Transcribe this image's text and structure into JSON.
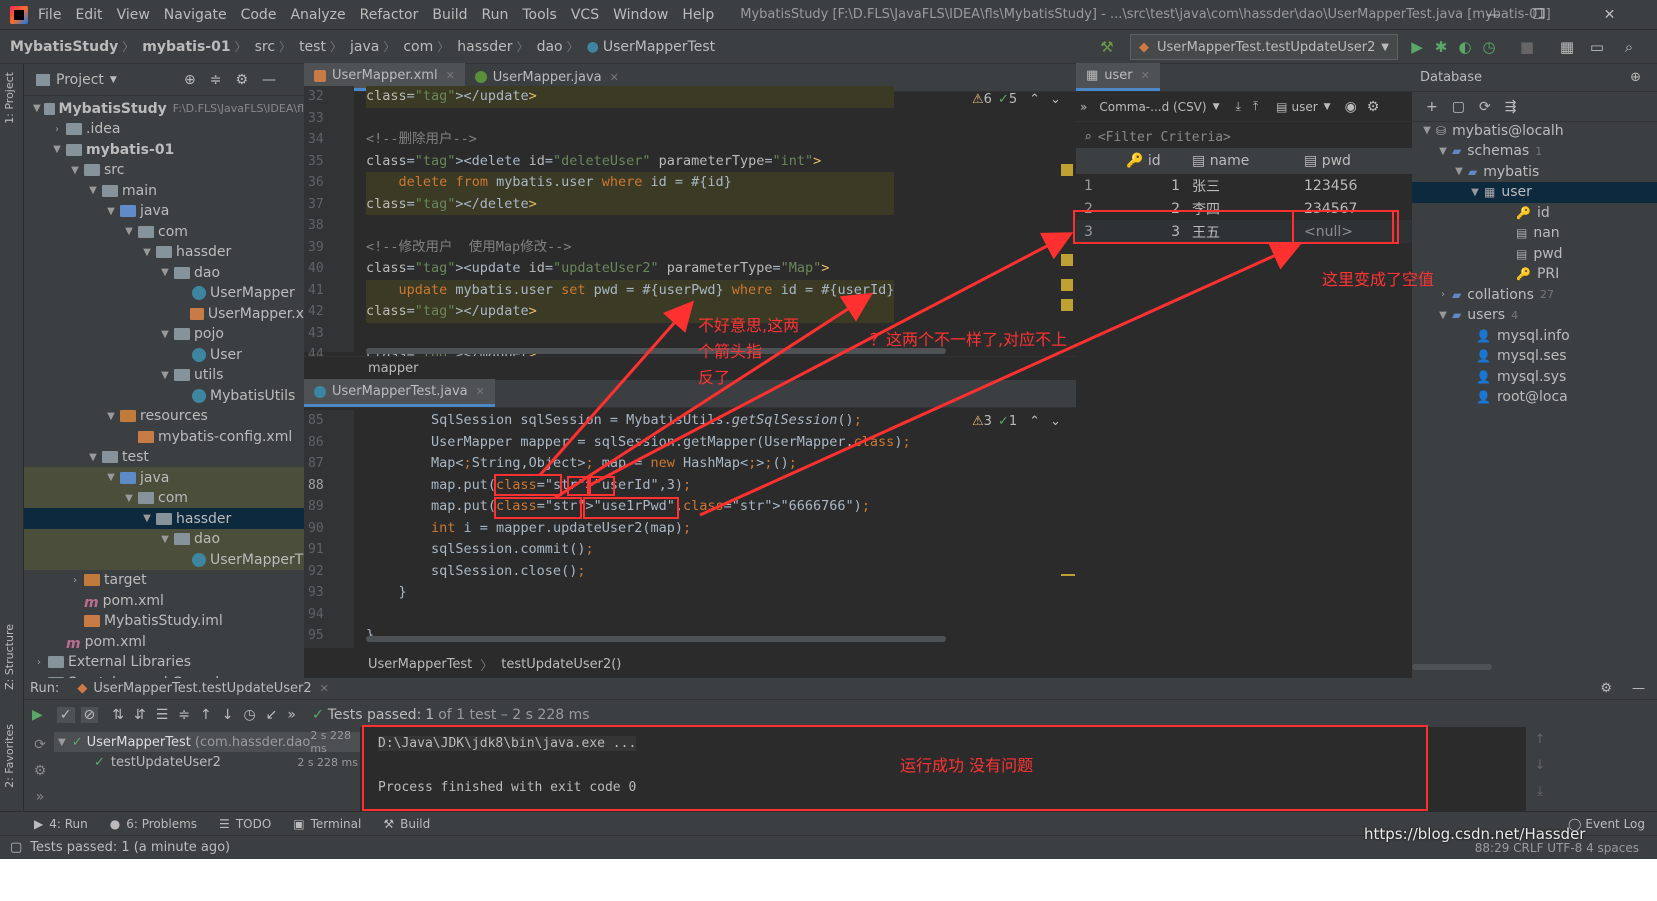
{
  "menubar": {
    "items": [
      "File",
      "Edit",
      "View",
      "Navigate",
      "Code",
      "Analyze",
      "Refactor",
      "Build",
      "Run",
      "Tools",
      "VCS",
      "Window",
      "Help"
    ],
    "title": "MybatisStudy [F:\\D.FLS\\JavaFLS\\IDEA\\fls\\MybatisStudy] - ...\\src\\test\\java\\com\\hassder\\dao\\UserMapperTest.java [mybatis-01]"
  },
  "breadcrumb": [
    "MybatisStudy",
    "mybatis-01",
    "src",
    "test",
    "java",
    "com",
    "hassder",
    "dao",
    "UserMapperTest"
  ],
  "run_config": "UserMapperTest.testUpdateUser2",
  "project": {
    "title": "Project",
    "tree": [
      {
        "label": "MybatisStudy",
        "extra": "F:\\D.FLS\\JavaFLS\\IDEA\\fl"
      },
      {
        "label": ".idea"
      },
      {
        "label": "mybatis-01"
      },
      {
        "label": "src"
      },
      {
        "label": "main"
      },
      {
        "label": "java"
      },
      {
        "label": "com"
      },
      {
        "label": "hassder"
      },
      {
        "label": "dao"
      },
      {
        "label": "UserMapper"
      },
      {
        "label": "UserMapper.x"
      },
      {
        "label": "pojo"
      },
      {
        "label": "User"
      },
      {
        "label": "utils"
      },
      {
        "label": "MybatisUtils"
      },
      {
        "label": "resources"
      },
      {
        "label": "mybatis-config.xml"
      },
      {
        "label": "test"
      },
      {
        "label": "java"
      },
      {
        "label": "com"
      },
      {
        "label": "hassder"
      },
      {
        "label": "dao"
      },
      {
        "label": "UserMapperT"
      },
      {
        "label": "target"
      },
      {
        "label": "pom.xml"
      },
      {
        "label": "MybatisStudy.iml"
      },
      {
        "label": "pom.xml"
      },
      {
        "label": "External Libraries"
      },
      {
        "label": "Scratches and Consoles"
      }
    ]
  },
  "editor_top": {
    "tabs": [
      "UserMapper.xml",
      "UserMapper.java"
    ],
    "line_numbers": [
      "32",
      "33",
      "34",
      "35",
      "36",
      "37",
      "38",
      "39",
      "40",
      "41",
      "42",
      "43",
      "44"
    ],
    "lines": [
      {
        "t": "</update>"
      },
      {
        "t": ""
      },
      {
        "t": "<!--删除用户-->"
      },
      {
        "t": "<delete id=\"deleteUser\" parameterType=\"int\">"
      },
      {
        "t": "    delete from mybatis.user where id = #{id}"
      },
      {
        "t": "</delete>"
      },
      {
        "t": ""
      },
      {
        "t": "<!--修改用户  使用Map修改-->"
      },
      {
        "t": "<update id=\"updateUser2\" parameterType=\"Map\">"
      },
      {
        "t": "    update mybatis.user set pwd = #{userPwd} where id = #{userId}"
      },
      {
        "t": "</update>"
      },
      {
        "t": ""
      },
      {
        "t": "</mapper>"
      }
    ],
    "footer": "mapper",
    "warn": "6",
    "ok": "5"
  },
  "editor_bot": {
    "tabs": [
      "UserMapperTest.java"
    ],
    "line_numbers": [
      "85",
      "86",
      "87",
      "88",
      "89",
      "90",
      "91",
      "92",
      "93",
      "94",
      "95"
    ],
    "lines": [
      "        SqlSession sqlSession = MybatisUtils.getSqlSession();",
      "        UserMapper mapper = sqlSession.getMapper(UserMapper.class);",
      "        Map<String,Object> map = new HashMap<>();",
      "        map.put(\"userId\",3);",
      "        map.put(\"use1rPwd\",\"6666766\");",
      "        int i = mapper.updateUser2(map);",
      "        sqlSession.commit();",
      "        sqlSession.close();",
      "    }",
      "",
      "}"
    ],
    "crumb": [
      "UserMapperTest",
      "testUpdateUser2()"
    ],
    "warn": "3",
    "ok": "1"
  },
  "db_user": {
    "tab": "user",
    "format": "Comma-...d (CSV)",
    "table_sel": "user",
    "filter": "<Filter Criteria>",
    "columns": [
      "id",
      "name",
      "pwd"
    ],
    "rows": [
      [
        "1",
        "1",
        "张三",
        "123456"
      ],
      [
        "2",
        "2",
        "李四",
        "234567"
      ],
      [
        "3",
        "3",
        "王五",
        "<null>"
      ]
    ]
  },
  "database": {
    "title": "Database",
    "tree": [
      "mybatis@localh",
      "schemas",
      "1",
      "mybatis",
      "user",
      "id",
      "nan",
      "pwd",
      "PRI",
      "collations",
      "27",
      "users",
      "4",
      "mysql.info",
      "mysql.ses",
      "mysql.sys",
      "root@loca"
    ]
  },
  "run": {
    "label": "Run:",
    "tab": "UserMapperTest.testUpdateUser2",
    "passed": "Tests passed:",
    "passed_count": "1",
    "passed_rest": "of 1 test – 2 s 228 ms",
    "tree": [
      {
        "name": "UserMapperTest",
        "pkg": "(com.hassder.dao",
        "time": "2 s 228 ms"
      },
      {
        "name": "testUpdateUser2",
        "time": "2 s 228 ms"
      }
    ],
    "console": [
      "D:\\Java\\JDK\\jdk8\\bin\\java.exe ...",
      "",
      "Process finished with exit code 0"
    ]
  },
  "toolstrip": [
    "4: Run",
    "6: Problems",
    "TODO",
    "Terminal",
    "Build"
  ],
  "event_log": "Event Log",
  "status": {
    "left": "Tests passed: 1 (a minute ago)",
    "right": "88:29  CRLF  UTF-8  4 spaces"
  },
  "watermark": "https://blog.csdn.net/Hassder",
  "annotations": {
    "a1": "不好意思,这两",
    "a1b": "个箭头指",
    "a1c": "反了",
    "a2": "？这两个不一样了,对应不上",
    "a3": "这里变成了空值",
    "a4": "运行成功 没有问题"
  },
  "colors": {
    "annotation": "#ff3030",
    "accent": "#4a88c7"
  }
}
